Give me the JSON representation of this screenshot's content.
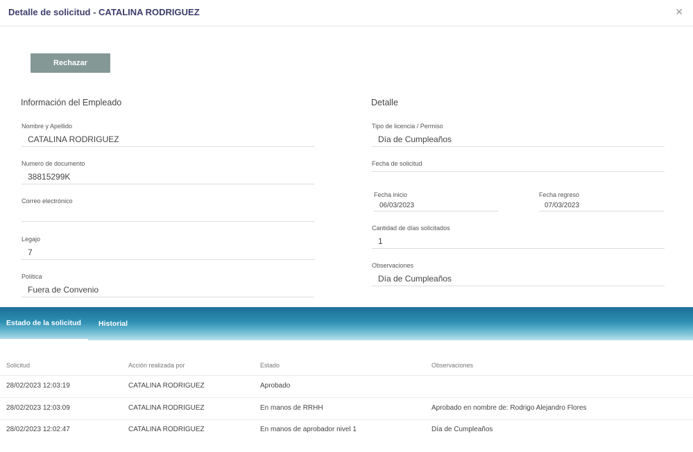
{
  "header": {
    "title": "Detalle de solicitud - CATALINA RODRIGUEZ"
  },
  "actions": {
    "reject_label": "Rechazar"
  },
  "employee": {
    "section_title": "Información del Empleado",
    "name_label": "Nombre y Apellido",
    "name_value": "CATALINA RODRIGUEZ",
    "doc_label": "Numero de documento",
    "doc_value": "38815299K",
    "email_label": "Correo electrónico",
    "email_value": "",
    "legajo_label": "Legajo",
    "legajo_value": "7",
    "politica_label": "Política",
    "politica_value": "Fuera de Convenio"
  },
  "detail": {
    "section_title": "Detalle",
    "tipo_label": "Tipo de licencia / Permiso",
    "tipo_value": "Día de Cumpleaños",
    "fecha_solicitud_label": "Fecha de solicitud",
    "fecha_solicitud_value": "",
    "fecha_inicio_label": "Fecha inicio",
    "fecha_inicio_value": "06/03/2023",
    "fecha_regreso_label": "Fecha regreso",
    "fecha_regreso_value": "07/03/2023",
    "cantidad_label": "Cantidad de días solicitados",
    "cantidad_value": "1",
    "obs_label": "Observaciones",
    "obs_value": "Día de Cumpleaños"
  },
  "tabs": [
    {
      "label": "Estado de la solicitud"
    },
    {
      "label": "Historial"
    }
  ],
  "table": {
    "headers": [
      "Solicitud",
      "Acción realizada por",
      "Estado",
      "Observaciones"
    ],
    "rows": [
      [
        "28/02/2023 12:03:19",
        "CATALINA RODRIGUEZ",
        "Aprobado",
        ""
      ],
      [
        "28/02/2023 12:03:09",
        "CATALINA RODRIGUEZ",
        "En manos de RRHH",
        "Aprobado en nombre de: Rodrigo Alejandro Flores"
      ],
      [
        "28/02/2023 12:02:47",
        "CATALINA RODRIGUEZ",
        "En manos de aprobador nivel 1",
        "Día de Cumpleaños"
      ]
    ]
  }
}
